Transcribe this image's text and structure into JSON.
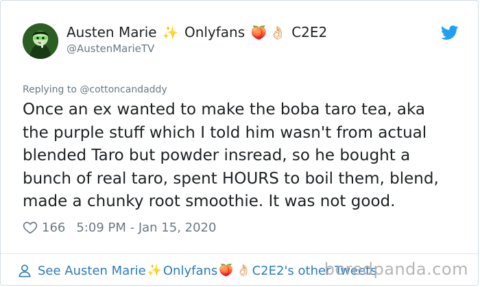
{
  "author": {
    "name": "Austen Marie",
    "name_suffix": "Onlyfans",
    "name_tail": "C2E2",
    "handle": "@AustenMarieTV",
    "emoji_sparkles": "✨",
    "emoji_peach": "🍑",
    "emoji_ok": "👌🏻"
  },
  "tweet": {
    "replying_to": "Replying to @cottoncandaddy",
    "text": "Once an ex wanted to make the boba taro tea, aka\nthe purple stuff which I told him wasn't from actual\nblended Taro but powder insread, so he bought a\nbunch of real taro, spent HOURS to boil them, blend,\nmade a chunky root smoothie. It was not good.",
    "likes": "166",
    "timestamp": "5:09 PM - Jan 15, 2020"
  },
  "footer": {
    "see_prefix": "See Austen Marie",
    "see_mid": "Onlyfans",
    "see_suffix": "C2E2's other Tweets"
  },
  "watermark": "boredpanda.com",
  "colors": {
    "link": "#2b7bb9",
    "muted": "#697882",
    "twitter_blue": "#1da1f2",
    "text": "#1c2022"
  },
  "icons": [
    "twitter-bird-icon",
    "heart-icon",
    "person-icon"
  ]
}
